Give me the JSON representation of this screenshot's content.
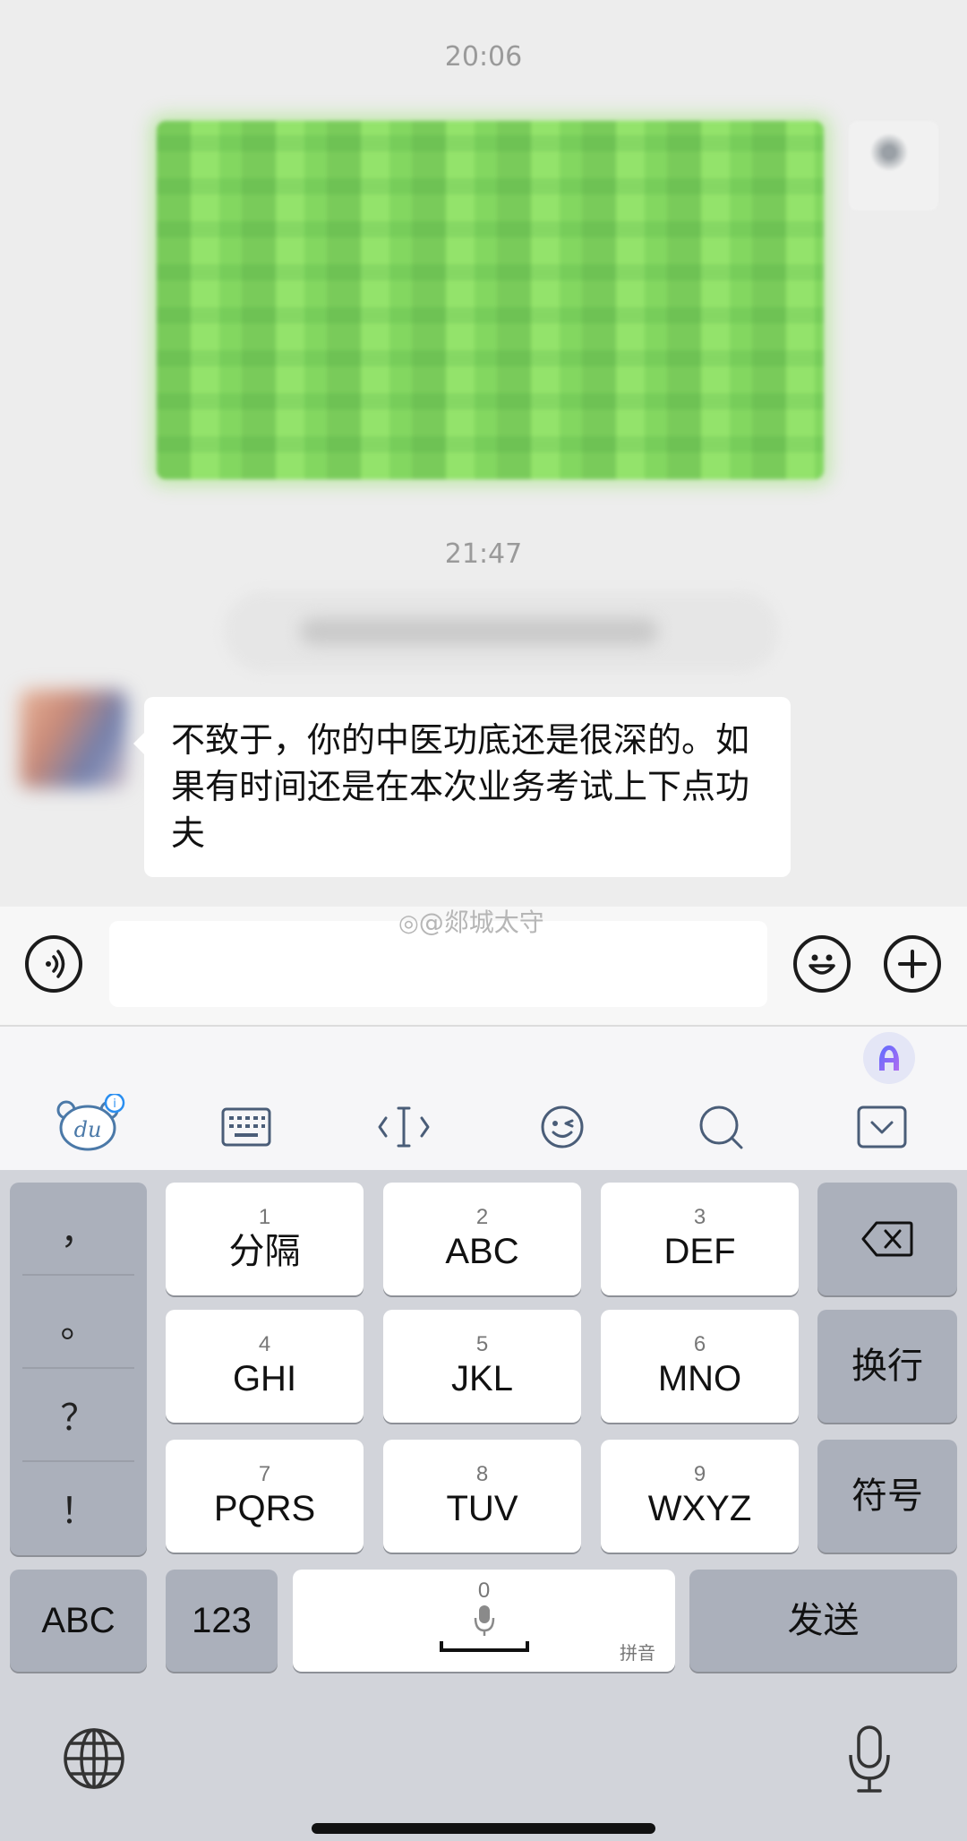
{
  "chat": {
    "time1": "20:06",
    "time2": "21:47",
    "incoming_message": "不致于，你的中医功底还是很深的。如果有时间还是在本次业务考试上下点功夫"
  },
  "watermark": "@郯城太守",
  "ime_toolbar": {
    "icons": [
      "du-bear-icon",
      "keyboard-icon",
      "cursor-icon",
      "emoji-face-icon",
      "search-icon",
      "collapse-keyboard-icon"
    ],
    "badge": "i"
  },
  "keyboard": {
    "punctuation": [
      "，",
      "。",
      "？",
      "！"
    ],
    "keys": [
      {
        "num": "1",
        "label": "分隔"
      },
      {
        "num": "2",
        "label": "ABC"
      },
      {
        "num": "3",
        "label": "DEF"
      },
      {
        "num": "4",
        "label": "GHI"
      },
      {
        "num": "5",
        "label": "JKL"
      },
      {
        "num": "6",
        "label": "MNO"
      },
      {
        "num": "7",
        "label": "PQRS"
      },
      {
        "num": "8",
        "label": "TUV"
      },
      {
        "num": "9",
        "label": "WXYZ"
      }
    ],
    "return_label": "换行",
    "symbols_label": "符号",
    "abc_label": "ABC",
    "num_label": "123",
    "space_num": "0",
    "space_hint": "拼音",
    "send_label": "发送"
  }
}
